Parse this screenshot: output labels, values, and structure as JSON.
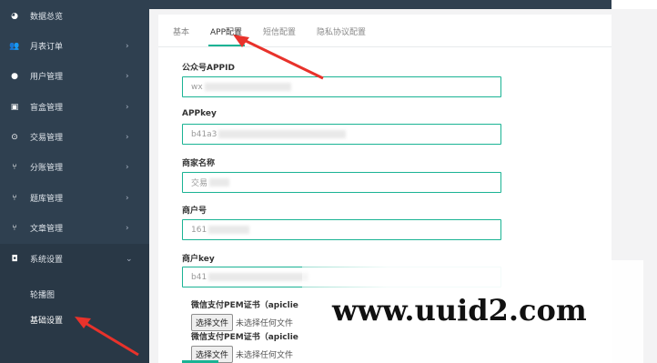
{
  "sidebar": {
    "items": [
      {
        "icon": "pie-chart-icon",
        "label": "数据总览",
        "arrow": ""
      },
      {
        "icon": "users-icon",
        "label": "月表订单",
        "arrow": "›"
      },
      {
        "icon": "user-icon",
        "label": "用户管理",
        "arrow": "›"
      },
      {
        "icon": "box-icon",
        "label": "盲盒管理",
        "arrow": "›"
      },
      {
        "icon": "exchange-icon",
        "label": "交易管理",
        "arrow": "›"
      },
      {
        "icon": "fork-icon",
        "label": "分账管理",
        "arrow": "›"
      },
      {
        "icon": "fork-icon",
        "label": "题库管理",
        "arrow": "›"
      },
      {
        "icon": "fork-icon",
        "label": "文章管理",
        "arrow": "›"
      },
      {
        "icon": "settings-icon",
        "label": "系统设置",
        "arrow": "⌄"
      }
    ],
    "sub_items": [
      {
        "label": "轮播图"
      },
      {
        "label": "基础设置"
      }
    ]
  },
  "tabs": [
    {
      "label": "基本"
    },
    {
      "label": "APP配置"
    },
    {
      "label": "短信配置"
    },
    {
      "label": "隐私协议配置"
    }
  ],
  "form": {
    "fields": [
      {
        "label": "公众号APPID",
        "value_visible": "wx"
      },
      {
        "label": "APPkey",
        "value_visible": "b41a3"
      },
      {
        "label": "商家名称",
        "value_visible": "交易"
      },
      {
        "label": "商户号",
        "value_visible": "161"
      },
      {
        "label": "商户key",
        "value_visible": "b41"
      }
    ],
    "certs": [
      {
        "label": "微信支付PEM证书（apiclie",
        "button": "选择文件",
        "status": "未选择任何文件"
      },
      {
        "label": "微信支付PEM证书（apiclie",
        "button": "选择文件",
        "status": "未选择任何文件"
      }
    ]
  },
  "watermark": "www.uuid2.com",
  "colors": {
    "sidebar_bg": "#2f4050",
    "accent": "#1ab394",
    "annotation_arrow": "#e8322b"
  }
}
